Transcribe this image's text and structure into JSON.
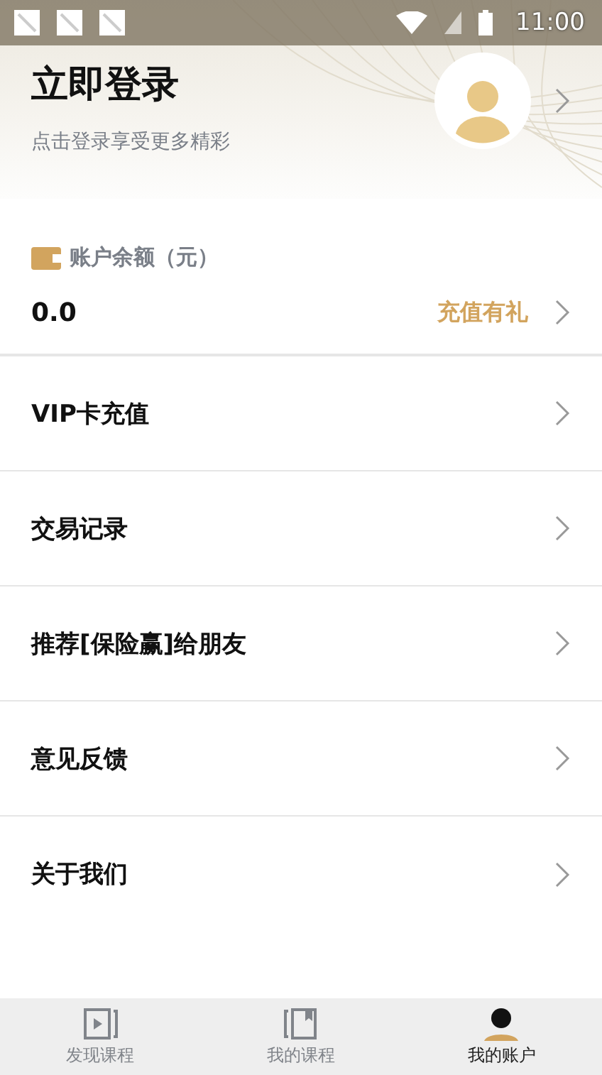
{
  "status_bar": {
    "time": "11:00"
  },
  "header": {
    "title": "立即登录",
    "subtitle": "点击登录享受更多精彩"
  },
  "balance": {
    "label": "账户余额（元）",
    "amount": "0.0",
    "action": "充值有礼"
  },
  "menu": [
    {
      "label": "VIP卡充值"
    },
    {
      "label": "交易记录"
    },
    {
      "label": "推荐[保险赢]给朋友"
    },
    {
      "label": "意见反馈"
    },
    {
      "label": "关于我们"
    }
  ],
  "tabs": [
    {
      "label": "发现课程",
      "selected": false,
      "kind": "video"
    },
    {
      "label": "我的课程",
      "selected": false,
      "kind": "book"
    },
    {
      "label": "我的账户",
      "selected": true,
      "kind": "user"
    }
  ]
}
